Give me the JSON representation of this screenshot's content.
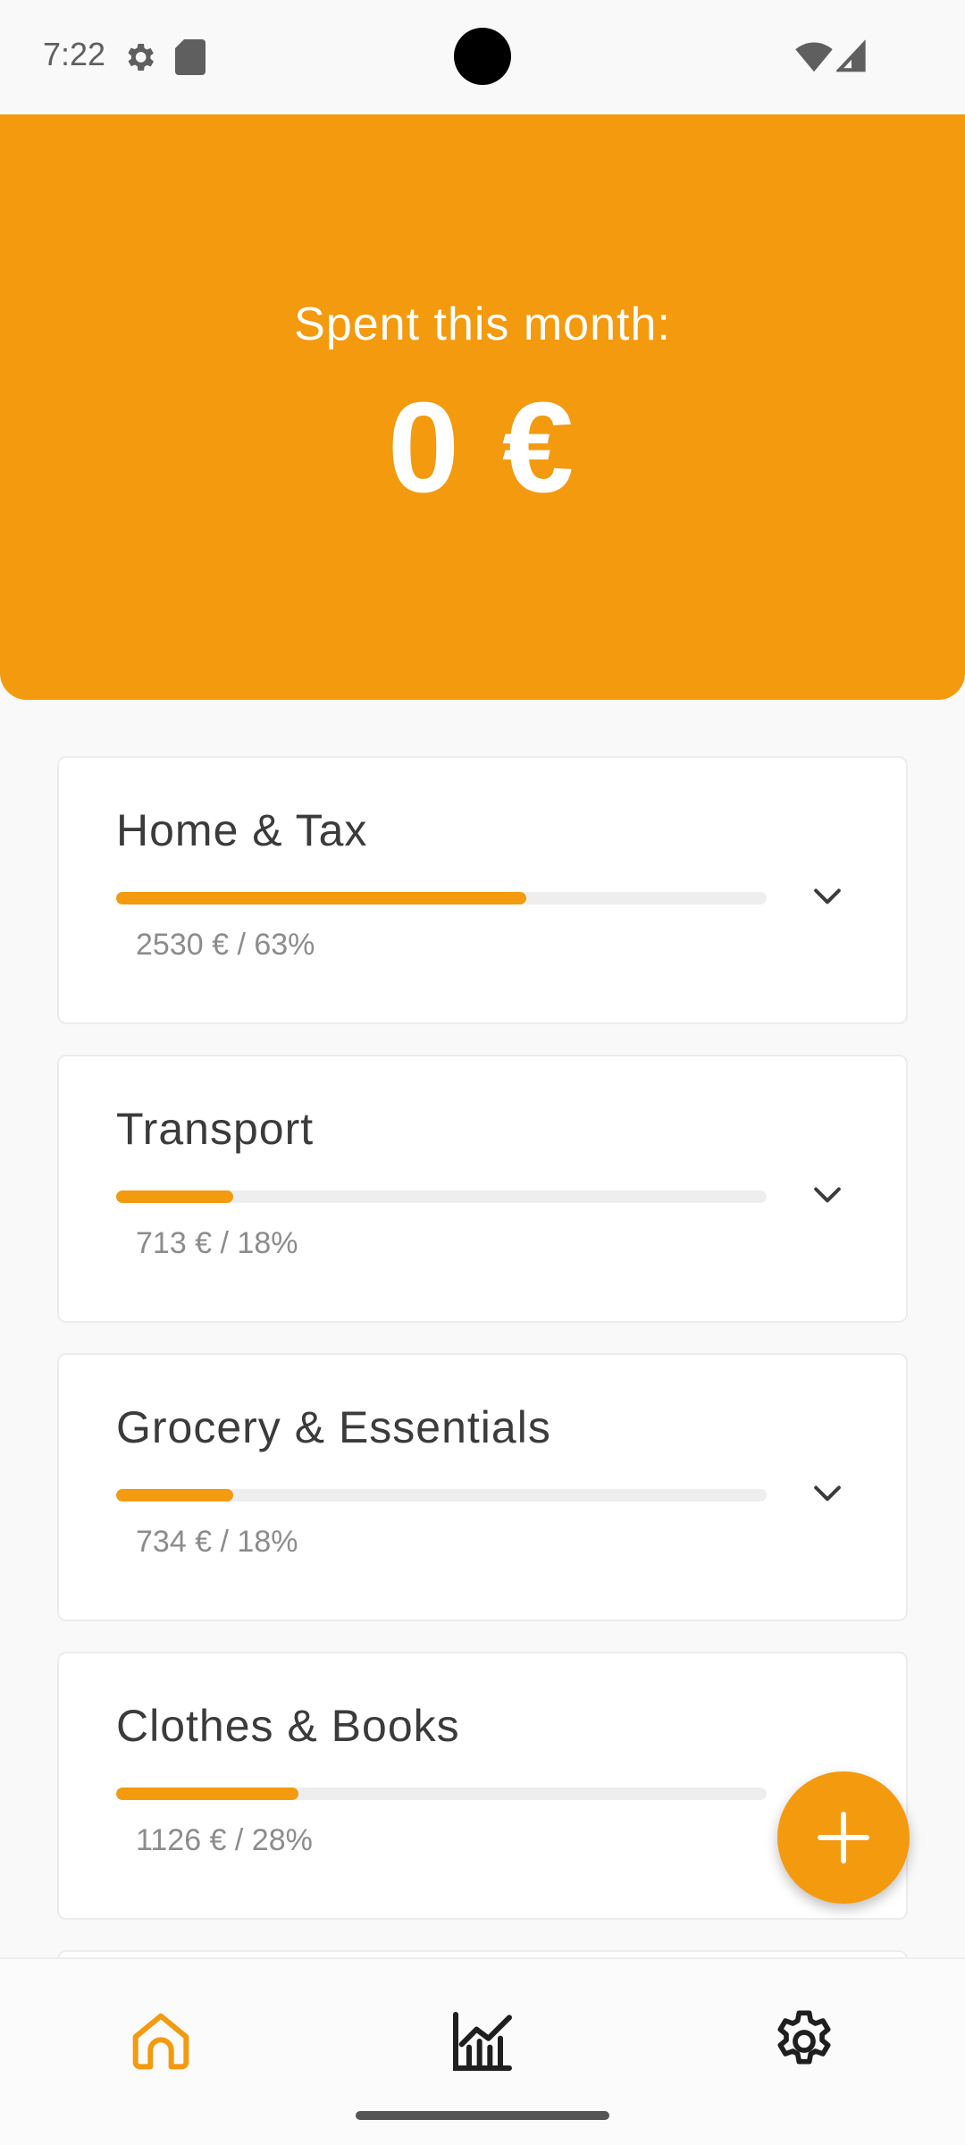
{
  "status_bar": {
    "time": "7:22",
    "icons": [
      "settings-gear-icon",
      "sd-card-icon",
      "wifi-icon",
      "cell-signal-icon"
    ]
  },
  "header": {
    "label": "Spent this month:",
    "amount": "0 €"
  },
  "categories": [
    {
      "name": "Home & Tax",
      "detail": "2530 € / 63%",
      "progress": 0.63
    },
    {
      "name": "Transport",
      "detail": "713 € / 18%",
      "progress": 0.18
    },
    {
      "name": "Grocery & Essentials",
      "detail": "734 € / 18%",
      "progress": 0.18
    },
    {
      "name": "Clothes & Books",
      "detail": "1126 € / 28%",
      "progress": 0.28
    }
  ],
  "fab": {
    "icon": "plus-icon"
  },
  "bottom_nav": {
    "items": [
      {
        "icon": "home-icon",
        "active": true
      },
      {
        "icon": "chart-icon",
        "active": false
      },
      {
        "icon": "gear-icon",
        "active": false
      }
    ]
  },
  "colors": {
    "accent": "#f39a0f",
    "background": "#f9f9f9",
    "card": "#ffffff",
    "text_dark": "#3b3b3b",
    "text_muted": "#8c8c8c",
    "track": "#eeeeee"
  }
}
